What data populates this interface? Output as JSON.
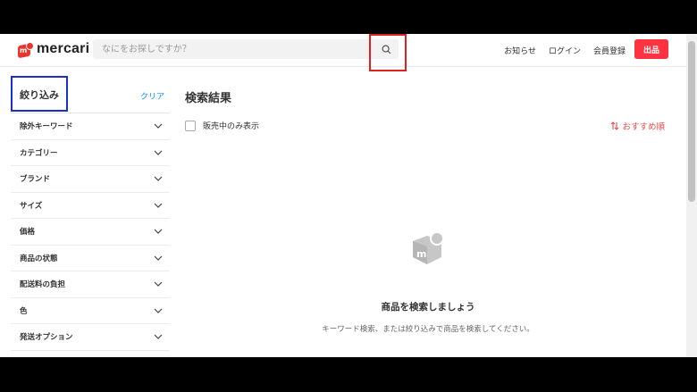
{
  "header": {
    "logo_text": "mercari",
    "search_placeholder": "なにをお探しですか？",
    "nav": [
      "お知らせ",
      "ログイン",
      "会員登録"
    ],
    "sell_label": "出品"
  },
  "sidebar": {
    "title": "絞り込み",
    "clear_label": "クリア",
    "filters": [
      {
        "label": "除外キーワード"
      },
      {
        "label": "カテゴリー"
      },
      {
        "label": "ブランド"
      },
      {
        "label": "サイズ"
      },
      {
        "label": "価格"
      },
      {
        "label": "商品の状態"
      },
      {
        "label": "配送料の負担"
      },
      {
        "label": "色"
      },
      {
        "label": "発送オプション"
      }
    ]
  },
  "main": {
    "title": "検索結果",
    "onsale_label": "販売中のみ表示",
    "sort_label": "おすすめ順",
    "empty_title": "商品を検索しましょう",
    "empty_sub": "キーワード検索、または絞り込みで商品を検索してください。"
  },
  "colors": {
    "brand": "#ff333f",
    "sort": "#e94a4a",
    "link": "#0095ee",
    "highlight_red": "#e02020",
    "highlight_blue": "#1b2fc5"
  },
  "icons": [
    "logo-icon",
    "search-icon",
    "chevron-down-icon",
    "sort-icon",
    "empty-state-icon"
  ]
}
